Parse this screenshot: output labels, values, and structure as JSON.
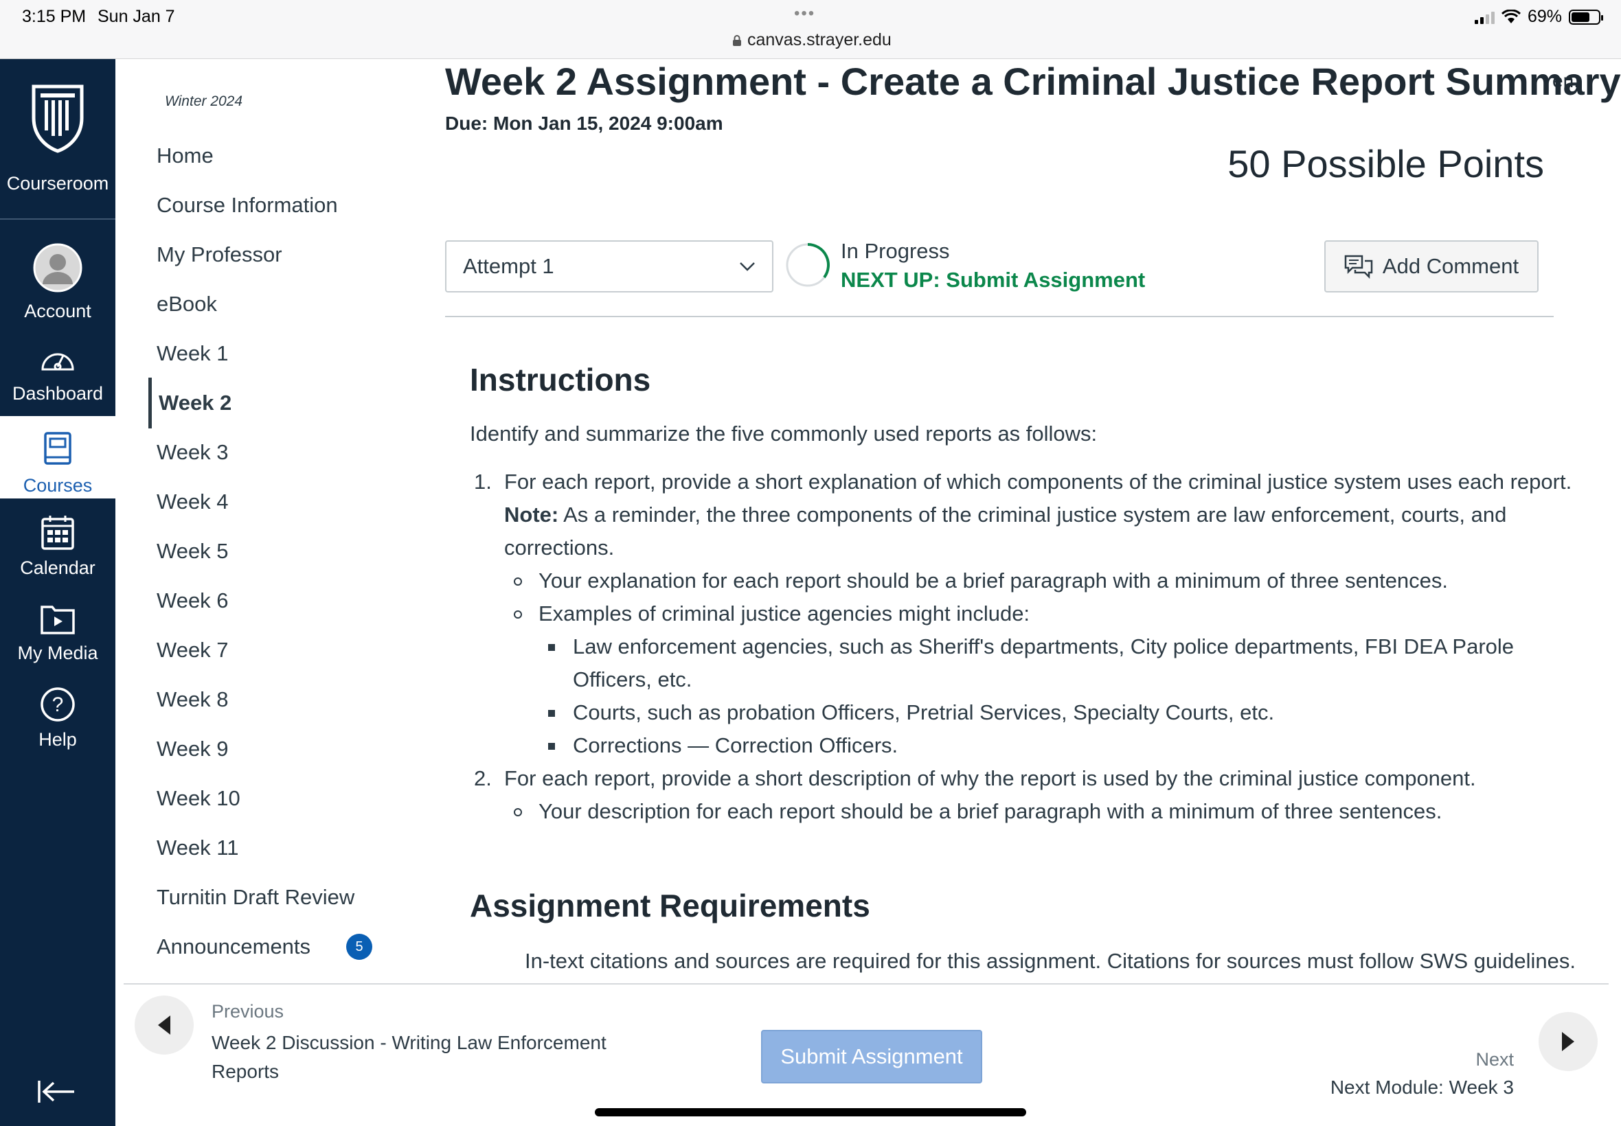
{
  "status_bar": {
    "time": "3:15 PM",
    "date": "Sun Jan 7",
    "url": "canvas.strayer.edu",
    "battery": "69%",
    "battery_level": 0.69,
    "tab_dots": "•••"
  },
  "global_nav": {
    "brand_label": "Courseroom",
    "items": [
      {
        "label": "Account",
        "icon": "account-avatar-icon"
      },
      {
        "label": "Dashboard",
        "icon": "dashboard-gauge-icon"
      },
      {
        "label": "Courses",
        "icon": "book-icon",
        "active": true
      },
      {
        "label": "Calendar",
        "icon": "calendar-icon"
      },
      {
        "label": "My Media",
        "icon": "media-folder-icon"
      },
      {
        "label": "Help",
        "icon": "help-circle-icon"
      }
    ],
    "collapse_icon": "collapse-arrow-icon",
    "active_color": "#1b5fb0",
    "bg_color": "#0b2440"
  },
  "course_nav": {
    "term": "Winter 2024",
    "items": [
      {
        "label": "Home"
      },
      {
        "label": "Course Information"
      },
      {
        "label": "My Professor"
      },
      {
        "label": "eBook"
      },
      {
        "label": "Week 1"
      },
      {
        "label": "Week 2",
        "active": true
      },
      {
        "label": "Week 3"
      },
      {
        "label": "Week 4"
      },
      {
        "label": "Week 5"
      },
      {
        "label": "Week 6"
      },
      {
        "label": "Week 7"
      },
      {
        "label": "Week 8"
      },
      {
        "label": "Week 9"
      },
      {
        "label": "Week 10"
      },
      {
        "label": "Week 11"
      },
      {
        "label": "Turnitin Draft Review"
      },
      {
        "label": "Announcements",
        "badge": "5"
      }
    ]
  },
  "assignment": {
    "title": "Week 2 Assignment - Create a Criminal Justice Report Summary",
    "cutoff_text": "en,",
    "due": "Due: Mon Jan 15, 2024 9:00am",
    "points": "50 Possible Points",
    "attempt_select": "Attempt 1",
    "status": "In Progress",
    "next_up": "NEXT UP: Submit Assignment",
    "add_comment": "Add Comment",
    "next_up_color": "#0b874b"
  },
  "instructions": {
    "heading": "Instructions",
    "intro": "Identify and summarize the five commonly used reports as follows:",
    "items": [
      {
        "num": "1.",
        "text": "For each report, provide a short explanation of which components of the criminal justice system uses each report.",
        "note_label": "Note:",
        "note_text": " As a reminder, the three components of the criminal justice system are law enforcement, courts, and corrections.",
        "sub": [
          {
            "text": "Your explanation for each report should be a brief paragraph with a minimum of three sentences."
          },
          {
            "text": "Examples of criminal justice agencies might include:",
            "sub": [
              "Law enforcement agencies, such as Sheriff's departments, City police departments, FBI DEA Parole Officers, etc.",
              "Courts, such as probation Officers, Pretrial Services, Specialty Courts, etc.",
              "Corrections — Correction Officers."
            ]
          }
        ]
      },
      {
        "num": "2.",
        "text": "For each report, provide a short description of why the report is used by the criminal justice component.",
        "sub": [
          {
            "text": "Your description for each report should be a brief paragraph with a minimum of three sentences."
          }
        ]
      }
    ]
  },
  "requirements": {
    "heading": "Assignment Requirements",
    "text": "In-text citations and sources are required for this assignment. Citations for sources must follow SWS guidelines."
  },
  "footer": {
    "previous_label": "Previous",
    "previous_title": "Week 2 Discussion - Writing Law Enforcement Reports",
    "submit": "Submit Assignment",
    "next_label": "Next",
    "next_title": "Next Module: Week 3"
  }
}
